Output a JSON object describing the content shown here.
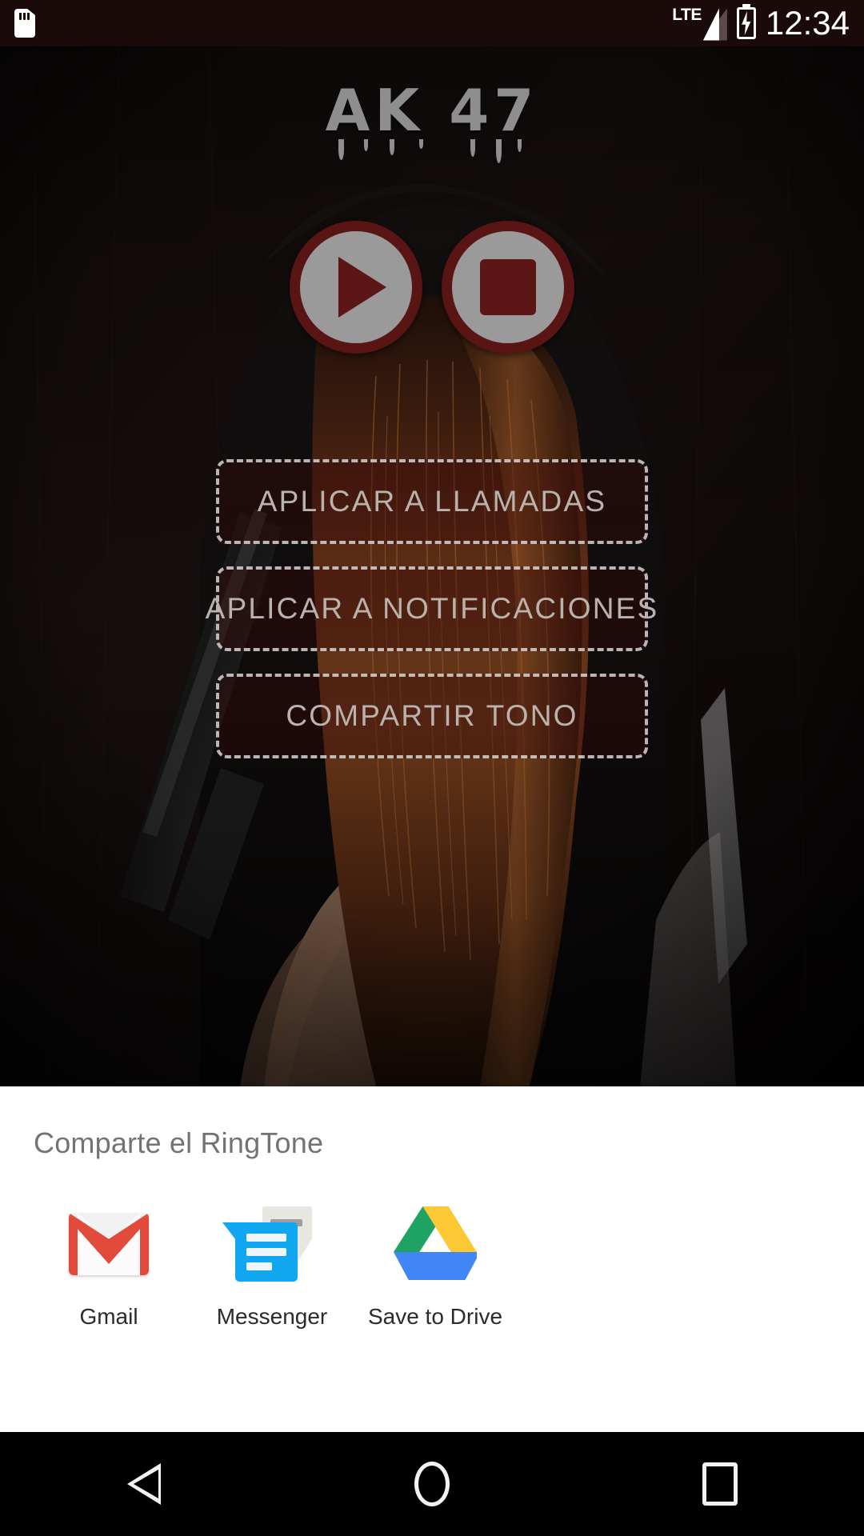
{
  "status_bar": {
    "sd_card_icon": "sd-card-icon",
    "network_label": "LTE",
    "signal_icon": "signal-bars-icon",
    "battery_icon": "battery-charging-icon",
    "time": "12:34"
  },
  "app": {
    "title": "AK 47",
    "title_color": "#8e8e8e",
    "accent_color": "#591414",
    "button_face_color": "#9a9a9a"
  },
  "transport": {
    "play_label": "play-button",
    "stop_label": "stop-button"
  },
  "actions": [
    {
      "label": "APLICAR A LLAMADAS",
      "name": "apply-to-calls-button"
    },
    {
      "label": "APLICAR A NOTIFICACIONES",
      "name": "apply-to-notifications-button"
    },
    {
      "label": "COMPARTIR TONO",
      "name": "share-ringtone-button"
    }
  ],
  "share_sheet": {
    "title": "Comparte el RingTone",
    "apps": [
      {
        "label": "Gmail",
        "icon": "gmail-icon"
      },
      {
        "label": "Messenger",
        "icon": "messenger-icon"
      },
      {
        "label": "Save to Drive",
        "icon": "google-drive-icon"
      }
    ]
  },
  "nav_bar": {
    "back": "back-button",
    "home": "home-button",
    "recents": "recents-button"
  }
}
